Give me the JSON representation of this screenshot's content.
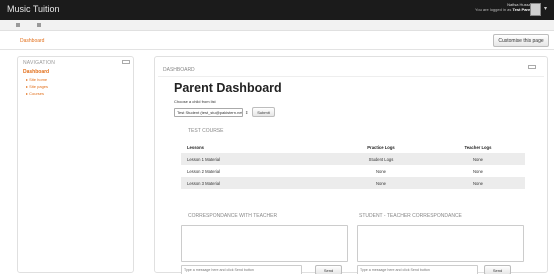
{
  "topbar": {
    "site_name": "Music Tuition",
    "user_name": "Nafisa Hussain",
    "logged_in_text": "You are logged in as",
    "role": "Test Parent"
  },
  "breadcrumb": "Dashboard",
  "customise_button": "Customise this page",
  "navigation": {
    "title": "NAVIGATION",
    "active": "Dashboard",
    "items": [
      "Site home",
      "Site pages",
      "Courses"
    ]
  },
  "main": {
    "block_title": "DASHBOARD",
    "page_title": "Parent Dashboard",
    "child_label": "Choose a child from list",
    "child_selected": "Test Student (test_stu@pakistern.net)",
    "submit_label": "Submit",
    "course_title": "TEST COURSE",
    "table": {
      "headers": [
        "Lessons",
        "Practice Logs",
        "Teacher Logs"
      ],
      "rows": [
        [
          "Lesson 1 Material",
          "Student Logs",
          "None"
        ],
        [
          "Lesson 2 Material",
          "None",
          "None"
        ],
        [
          "Lesson 3 Material",
          "None",
          "None"
        ]
      ]
    },
    "correspondence_teacher": {
      "title": "CORRESPONDANCE WITH TEACHER",
      "placeholder": "Type a message here and click Send button",
      "send_label": "Send"
    },
    "student_teacher": {
      "title": "STUDENT - TEACHER CORRESPONDANCE",
      "placeholder": "Type a message here and click Send button",
      "send_label": "Send"
    }
  },
  "colors": {
    "accent": "#e2701c",
    "topbar": "#1b1b1b"
  }
}
